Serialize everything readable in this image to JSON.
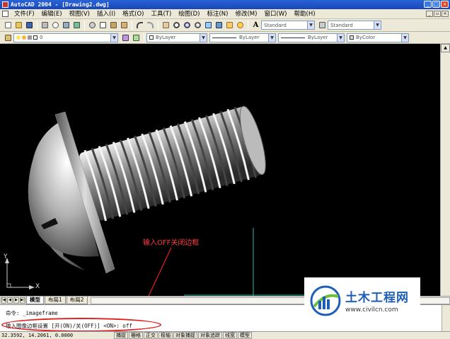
{
  "window": {
    "title": "AutoCAD 2004 - [Drawing2.dwg]",
    "buttons": [
      "_",
      "□",
      "×"
    ]
  },
  "menubar": {
    "items": [
      "文件(F)",
      "编辑(E)",
      "视图(V)",
      "插入(I)",
      "格式(O)",
      "工具(T)",
      "绘图(D)",
      "标注(N)",
      "修改(M)",
      "窗口(W)",
      "帮助(H)"
    ]
  },
  "toolbar": {
    "text_style": "Standard",
    "dim_style": "Standard",
    "layer_value": "0",
    "color_value": "ByLayer",
    "linetype_value": "ByLayer",
    "lineweight_value": "ByLayer",
    "plotstyle_value": "ByColor"
  },
  "canvas": {
    "annotation": "输入OFF关闭边框",
    "ucs_x": "X",
    "ucs_y": "Y",
    "annotation_color": "#ff3b3b"
  },
  "tabs": [
    "模型",
    "布局1",
    "布局2"
  ],
  "command": {
    "line1": "命令: _imageframe",
    "line2": "输入图像边框设置 [开(ON)/关(OFF)] <ON>: off"
  },
  "status": {
    "coords": "32.3592, 14.2061, 0.0000",
    "buttons": [
      "捕捉",
      "栅格",
      "正交",
      "极轴",
      "对象捕捉",
      "对象追踪",
      "线宽",
      "模型"
    ]
  },
  "watermark": {
    "name": "土木工程网",
    "url": "www.civilcn.com"
  }
}
